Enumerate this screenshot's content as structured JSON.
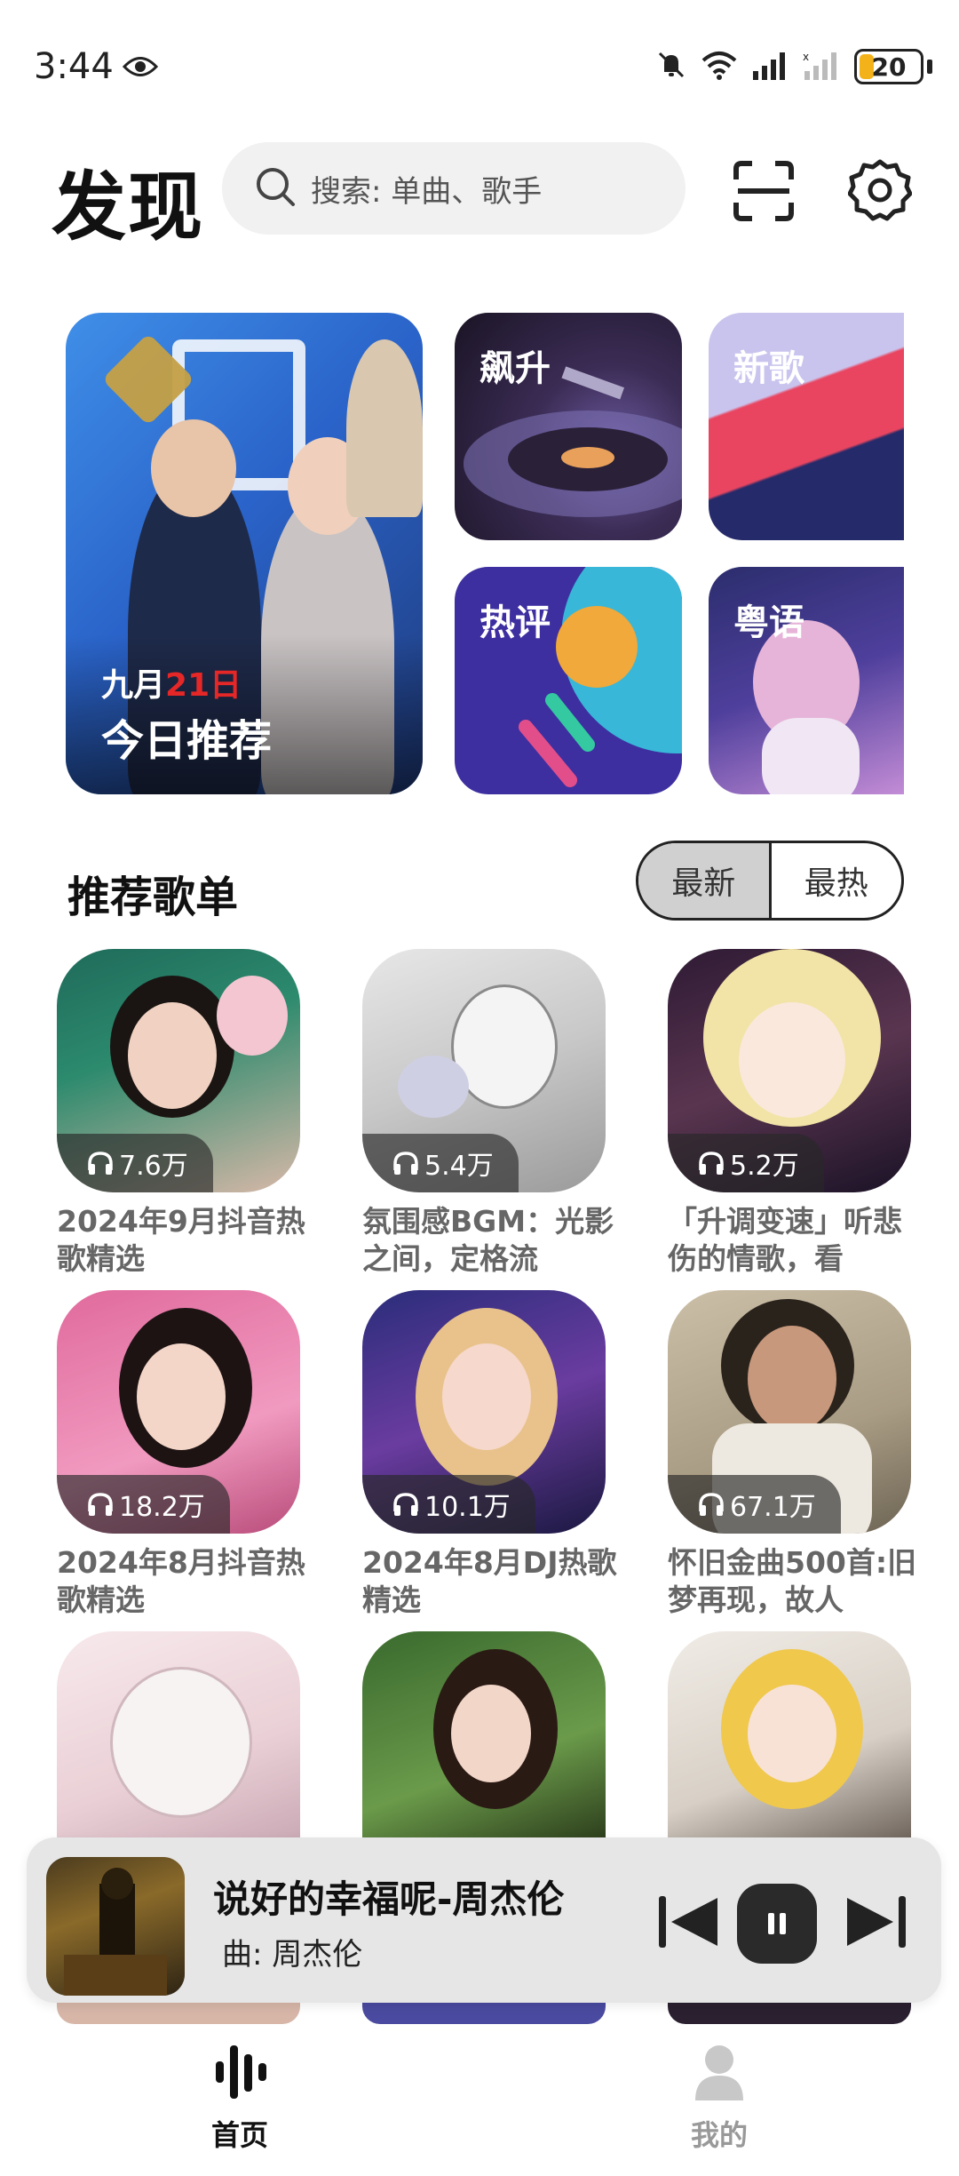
{
  "status_bar": {
    "time": "3:44",
    "battery": "20",
    "battery_color": "#f4b21a"
  },
  "header": {
    "title": "发现",
    "search_placeholder": "搜索: 单曲、歌手"
  },
  "featured": {
    "big": {
      "date_prefix": "九月",
      "date_num": "21日",
      "title": "今日推荐"
    },
    "tiles": [
      {
        "label": "飙升"
      },
      {
        "label": "新歌"
      },
      {
        "label": "热评"
      },
      {
        "label": "粤语"
      }
    ]
  },
  "section": {
    "title": "推荐歌单",
    "tabs": [
      "最新",
      "最热"
    ],
    "active_tab": "最新"
  },
  "playlists": [
    {
      "plays": "7.6万",
      "title": "2024年9月抖音热歌精选"
    },
    {
      "plays": "5.4万",
      "title": "氛围感BGM：光影之间，定格流"
    },
    {
      "plays": "5.2万",
      "title": "「升调变速」听悲伤的情歌，看"
    },
    {
      "plays": "18.2万",
      "title": "2024年8月抖音热歌精选"
    },
    {
      "plays": "10.1万",
      "title": "2024年8月DJ热歌精选"
    },
    {
      "plays": "67.1万",
      "title": "怀旧金曲500首:旧梦再现，故人"
    },
    {
      "plays": "",
      "title": ""
    },
    {
      "plays": "",
      "title": ""
    },
    {
      "plays": "",
      "title": ""
    }
  ],
  "now_playing": {
    "title": "说好的幸福呢-周杰伦",
    "artist": "曲:  周杰伦"
  },
  "bottom_nav": {
    "home": "首页",
    "me": "我的"
  }
}
